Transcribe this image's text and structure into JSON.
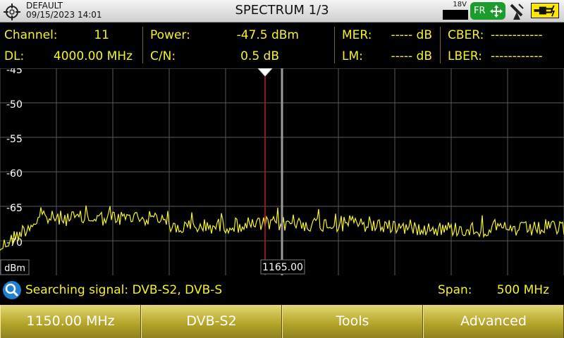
{
  "header": {
    "profile_name": "DEFAULT",
    "datetime": "09/15/2023 14:01",
    "title": "SPECTRUM 1/3",
    "lnb_voltage": "18V",
    "region_badge": "FR",
    "icons": [
      "crosshair-icon",
      "battery-icon",
      "satellite-dish-icon",
      "power-plug-icon"
    ]
  },
  "measurements": {
    "channel_label": "Channel:",
    "channel_value": "11",
    "dl_label": "DL:",
    "dl_value": "4000.00 MHz",
    "power_label": "Power:",
    "power_value": "-47.5 dBm",
    "cn_label": "C/N:",
    "cn_value": "0.5 dB",
    "mer_label": "MER:",
    "mer_value": "----- dB",
    "lm_label": "LM:",
    "lm_value": "----- dB",
    "cber_label": "CBER:",
    "cber_value": "------------",
    "lber_label": "LBER:",
    "lber_value": "------------"
  },
  "spectrum": {
    "y_ticks": [
      "-45",
      "-50",
      "-55",
      "-60",
      "-65",
      "-70"
    ],
    "y_unit": "dBm",
    "marker_label": "1165.00",
    "trace_color": "#f4f226",
    "marker_color": "#c0191e"
  },
  "status": {
    "message": "Searching signal: DVB-S2, DVB-S",
    "span_label": "Span:",
    "span_value": "500 MHz"
  },
  "softkeys": [
    "1150.00 MHz",
    "DVB-S2",
    "Tools",
    "Advanced"
  ]
}
